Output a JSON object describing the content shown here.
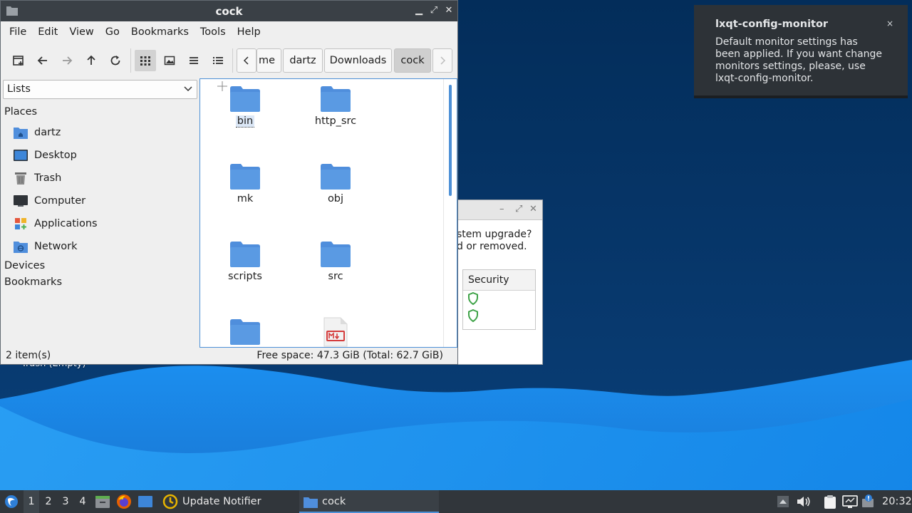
{
  "file_manager": {
    "title": "cock",
    "menu": [
      "File",
      "Edit",
      "View",
      "Go",
      "Bookmarks",
      "Tools",
      "Help"
    ],
    "breadcrumbs": [
      "me",
      "dartz",
      "Downloads",
      "cock"
    ],
    "side_panel_mode": "Lists",
    "places_header": "Places",
    "places": [
      {
        "label": "dartz",
        "icon": "home-folder-icon"
      },
      {
        "label": "Desktop",
        "icon": "desktop-icon"
      },
      {
        "label": "Trash",
        "icon": "trash-icon"
      },
      {
        "label": "Computer",
        "icon": "computer-icon"
      },
      {
        "label": "Applications",
        "icon": "applications-icon"
      },
      {
        "label": "Network",
        "icon": "network-icon"
      }
    ],
    "devices_header": "Devices",
    "bookmarks_header": "Bookmarks",
    "files": [
      "bin",
      "http_src",
      "mk",
      "obj",
      "scripts",
      "src"
    ],
    "status_left": "2 item(s)",
    "status_right": "Free space: 47.3 GiB (Total: 62.7 GiB)"
  },
  "update_window": {
    "text_line1": "stem upgrade?",
    "text_line2": "d or removed.",
    "column_header": "Security"
  },
  "desktop": {
    "trash_label": "Trash (Empty)"
  },
  "notification": {
    "title": "lxqt-config-monitor",
    "body": "Default monitor settings has been applied. If you want change monitors settings, please, use lxqt-config-monitor.",
    "close": "×"
  },
  "taskbar": {
    "workspaces": [
      "1",
      "2",
      "3",
      "4"
    ],
    "tasks": [
      "Update Notifier",
      "cock"
    ],
    "clock": "20:32"
  },
  "colors": {
    "accent": "#4d90d6",
    "folder": "#4f8edc",
    "titlebar": "#3a4046",
    "taskbar": "#31363b"
  }
}
